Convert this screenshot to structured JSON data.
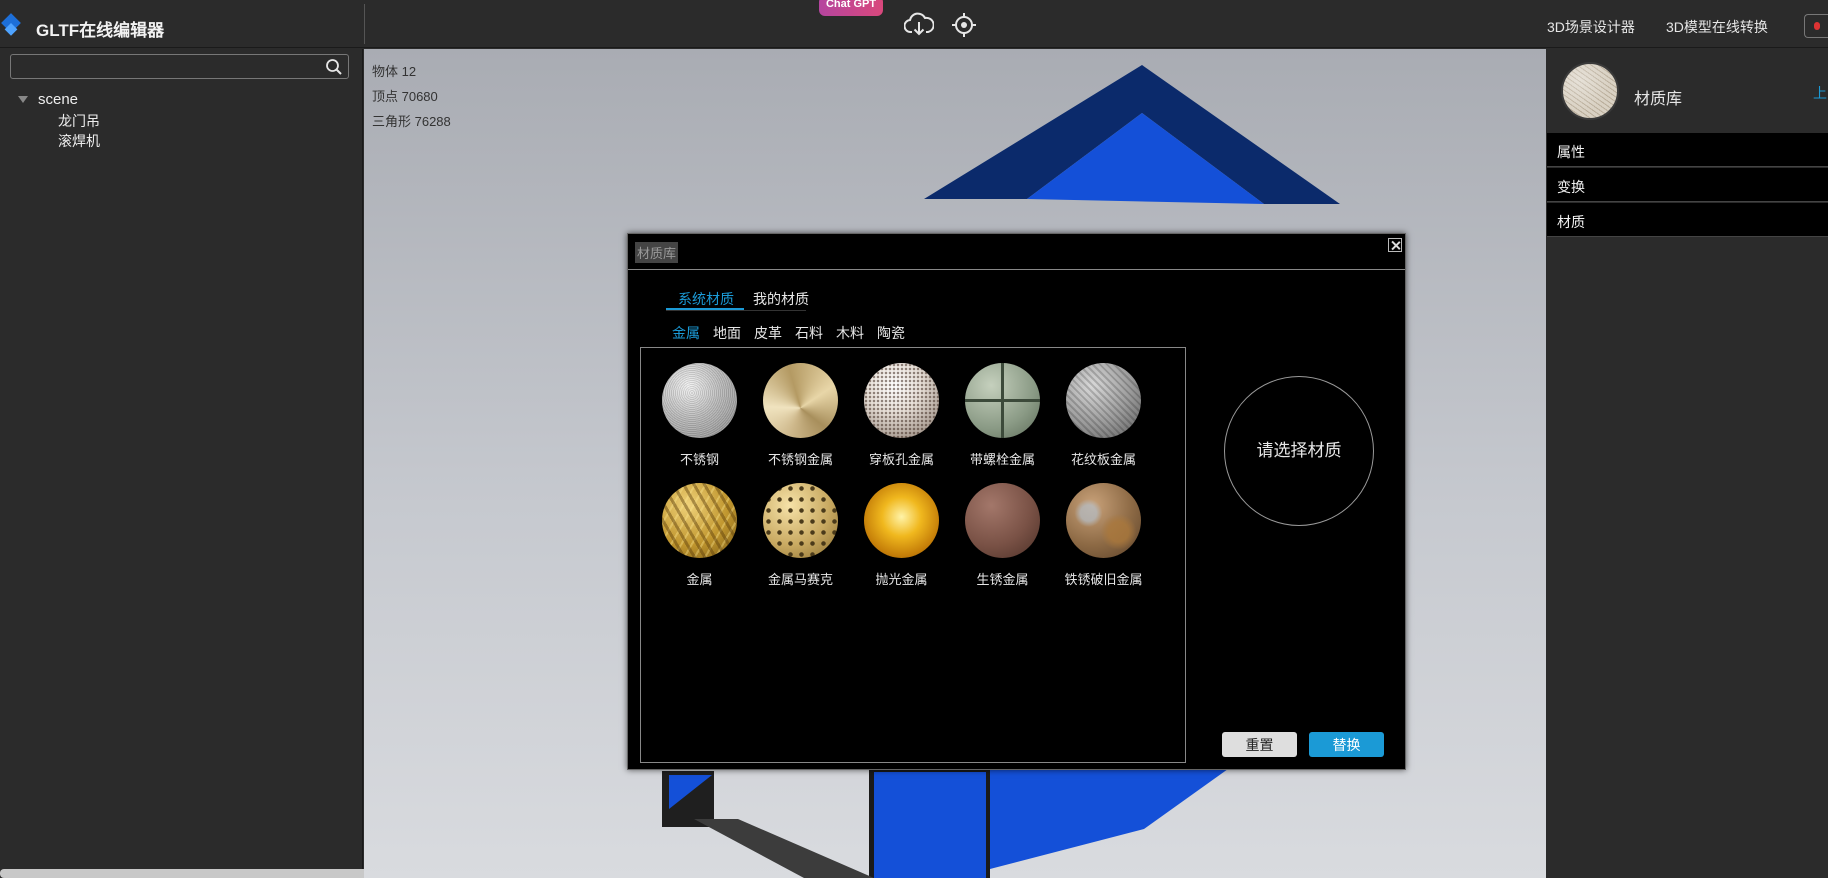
{
  "app": {
    "title": "GLTF在线编辑器",
    "chatgpt_badge": "Chat GPT",
    "top_links": [
      "3D场景设计器",
      "3D模型在线转换"
    ]
  },
  "sidebar": {
    "search_placeholder": "",
    "tree": {
      "root": "scene",
      "children": [
        "龙门吊",
        "滚焊机"
      ]
    }
  },
  "viewport": {
    "stats": [
      "物体 12",
      "顶点 70680",
      "三角形 76288"
    ]
  },
  "right_panel": {
    "material_lib_label": "材质库",
    "upload_link": "上",
    "sections": [
      "属性",
      "变换",
      "材质"
    ]
  },
  "modal": {
    "title": "材质库",
    "main_tabs": [
      "系统材质",
      "我的材质"
    ],
    "active_main_tab": "系统材质",
    "categories": [
      "金属",
      "地面",
      "皮革",
      "石料",
      "木料",
      "陶瓷"
    ],
    "active_category": "金属",
    "materials": [
      {
        "name": "不锈钢",
        "texture": "brushed-steel-noise"
      },
      {
        "name": "不锈钢金属",
        "texture": "gold-brushed-swirl"
      },
      {
        "name": "穿板孔金属",
        "texture": "perforated-metal"
      },
      {
        "name": "带螺栓金属",
        "texture": "bolted-plate-green"
      },
      {
        "name": "花纹板金属",
        "texture": "diamond-plate-gray"
      },
      {
        "name": "金属",
        "texture": "gold-tread-plate"
      },
      {
        "name": "金属马赛克",
        "texture": "gold-mosaic"
      },
      {
        "name": "抛光金属",
        "texture": "polished-gold"
      },
      {
        "name": "生锈金属",
        "texture": "rusty-brown"
      },
      {
        "name": "铁锈破旧金属",
        "texture": "worn-rust"
      }
    ],
    "preview_text": "请选择材质",
    "buttons": {
      "reset": "重置",
      "replace": "替换"
    }
  },
  "colors": {
    "accent": "#1b9ad6",
    "scene_blue": "#1450d8",
    "scene_dark_blue": "#0b2a6b"
  }
}
